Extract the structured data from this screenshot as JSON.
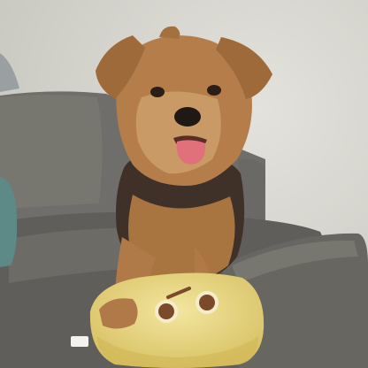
{
  "scene": {
    "subject": "yorkshire-terrier",
    "colors": {
      "wall": "#dcdbd5",
      "wall_shadow": "#c9c8c1",
      "sofa": "#6f6e6b",
      "sofa_dark": "#55544f",
      "sofa_light": "#86857f",
      "fur_tan": "#b07a48",
      "fur_light": "#c99a66",
      "fur_dark": "#4a3a2e",
      "tongue": "#e0707a",
      "toy_yellow": "#ecd982",
      "toy_shade": "#d6bd5c",
      "toy_eye": "#7a4a2a",
      "pillow_teal": "#5d8a86"
    }
  }
}
